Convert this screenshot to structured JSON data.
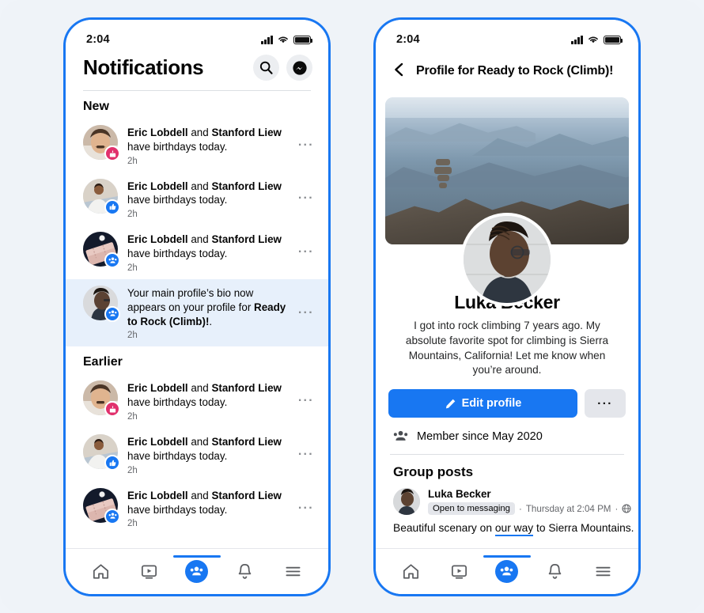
{
  "theme": {
    "brand_blue": "#1877f2",
    "highlight_bg": "#e7f0fb",
    "page_bg": "#eff3f8",
    "badge_pink": "#e1306c"
  },
  "left_phone": {
    "status": {
      "time": "2:04",
      "signal_icon": "signal-bars-icon",
      "wifi_icon": "wifi-icon",
      "battery_icon": "battery-icon"
    },
    "header": {
      "title": "Notifications",
      "search_icon": "search-icon",
      "messenger_icon": "messenger-icon"
    },
    "sections": [
      {
        "label": "New",
        "items": [
          {
            "names": "Eric Lobdell",
            "conjunction": " and ",
            "names2": "Stanford Liew",
            "body": "have birthdays today.",
            "time": "2h",
            "badge": "birthday-cake-icon",
            "badge_color": "pink",
            "avatar": "man-with-mustache",
            "menu": "···",
            "highlighted": false
          },
          {
            "names": "Eric Lobdell",
            "conjunction": " and ",
            "names2": "Stanford Liew",
            "body": "have birthdays today.",
            "time": "2h",
            "badge": "thumbs-up-icon",
            "badge_color": "blue",
            "avatar": "man-in-white-shirt",
            "menu": "···",
            "highlighted": false
          },
          {
            "names": "Eric Lobdell",
            "conjunction": " and ",
            "names2": "Stanford Liew",
            "body": "have birthdays today.",
            "time": "2h",
            "badge": "groups-icon",
            "badge_color": "blue",
            "avatar": "event-tickets",
            "menu": "···",
            "highlighted": false
          },
          {
            "plain_text_1": "Your main profile’s bio now appears on your profile for ",
            "bold_text": "Ready to Rock (Climb)!",
            "plain_text_2": ".",
            "time": "2h",
            "badge": "groups-icon",
            "badge_color": "blue",
            "avatar": "man-profile-photo",
            "menu": "···",
            "highlighted": true
          }
        ]
      },
      {
        "label": "Earlier",
        "items": [
          {
            "names": "Eric Lobdell",
            "conjunction": " and ",
            "names2": "Stanford Liew",
            "body": "have birthdays today.",
            "time": "2h",
            "badge": "birthday-cake-icon",
            "badge_color": "pink",
            "avatar": "man-with-mustache",
            "menu": "···",
            "highlighted": false
          },
          {
            "names": "Eric Lobdell",
            "conjunction": " and ",
            "names2": "Stanford Liew",
            "body": "have birthdays today.",
            "time": "2h",
            "badge": "thumbs-up-icon",
            "badge_color": "blue",
            "avatar": "man-in-white-shirt",
            "menu": "···",
            "highlighted": false
          },
          {
            "names": "Eric Lobdell",
            "conjunction": " and ",
            "names2": "Stanford Liew",
            "body": "have birthdays today.",
            "time": "2h",
            "badge": "groups-icon",
            "badge_color": "blue",
            "avatar": "event-tickets",
            "menu": "···",
            "highlighted": false
          }
        ]
      }
    ],
    "bottom_nav": [
      {
        "icon": "home-icon",
        "active": false
      },
      {
        "icon": "video-icon",
        "active": false
      },
      {
        "icon": "groups-icon",
        "active": true
      },
      {
        "icon": "bell-icon",
        "active": false
      },
      {
        "icon": "menu-icon",
        "active": false
      }
    ]
  },
  "right_phone": {
    "status": {
      "time": "2:04",
      "signal_icon": "signal-bars-icon",
      "wifi_icon": "wifi-icon",
      "battery_icon": "battery-icon"
    },
    "header": {
      "back_icon": "back-chevron-icon",
      "title": "Profile for Ready to Rock (Climb)!"
    },
    "cover_photo_alt": "mountain-range-with-rock-cairn",
    "profile_photo_alt": "man-in-profile-wearing-glasses",
    "name": "Luka Becker",
    "bio": "I got into rock climbing 7 years ago. My absolute favorite spot for climbing is Sierra Mountains, California! Let me know when you’re around.",
    "actions": {
      "edit_label": "Edit profile",
      "edit_icon": "pencil-icon",
      "more_label": "···"
    },
    "member_since": {
      "icon": "groups-icon",
      "text": "Member since May 2020"
    },
    "group_posts": {
      "title": "Group posts",
      "post": {
        "author": "Luka Becker",
        "chip": "Open to messaging",
        "separator_1": "·",
        "timestamp": "Thursday at 2:04 PM",
        "separator_2": "·",
        "audience_icon": "globe-icon",
        "menu": "···",
        "body_before": "Beautiful scenary on ",
        "body_link": "our way",
        "body_after": " to Sierra Mountains."
      }
    },
    "bottom_nav": [
      {
        "icon": "home-icon",
        "active": false
      },
      {
        "icon": "video-icon",
        "active": false
      },
      {
        "icon": "groups-icon",
        "active": true
      },
      {
        "icon": "bell-icon",
        "active": false
      },
      {
        "icon": "menu-icon",
        "active": false
      }
    ]
  }
}
